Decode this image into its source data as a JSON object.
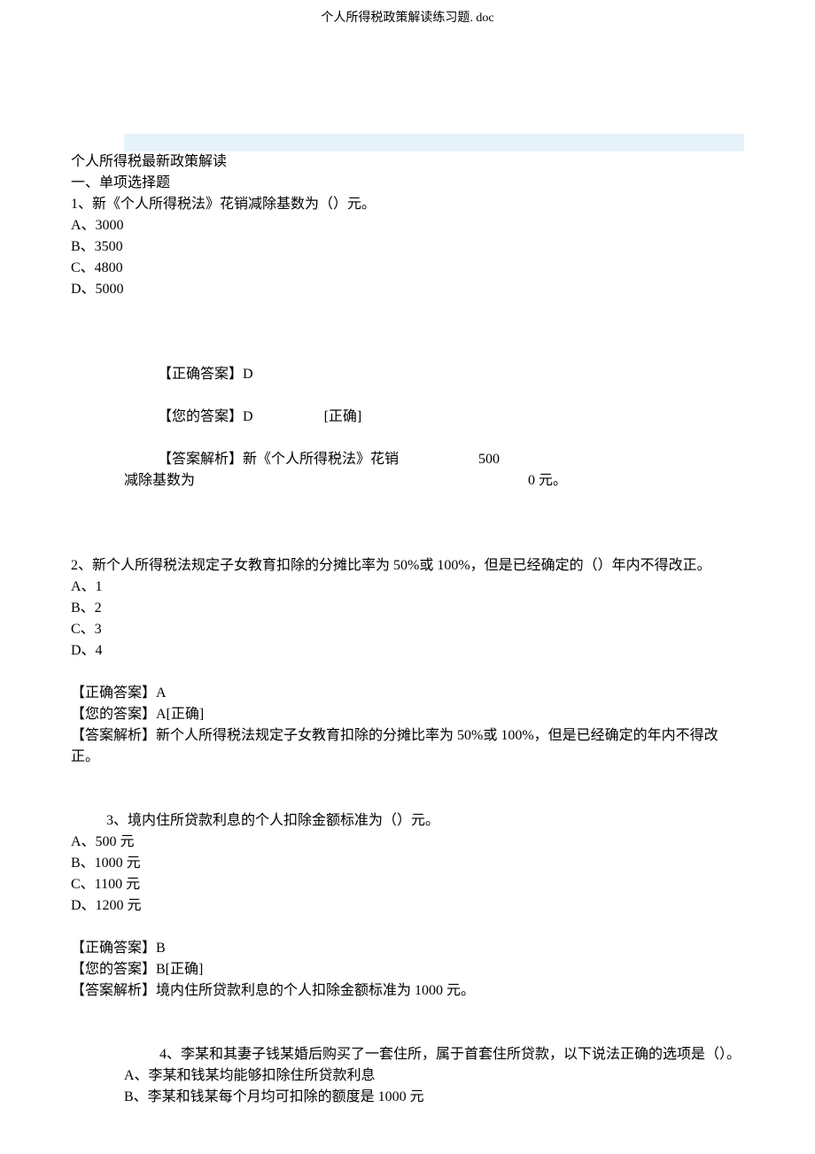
{
  "doc_filename": "个人所得税政策解读练习题. doc",
  "title": "个人所得税最新政策解读",
  "section_heading": "一、单项选择题",
  "q1": {
    "prompt": "1、新《个人所得税法》花销减除基数为（）元。",
    "opts": {
      "a": "A、3000",
      "b": "B、3500",
      "c": "C、4800",
      "d": "D、5000"
    },
    "correct_label": "【正确答案】D",
    "your_label": "【您的答案】D",
    "correct_tag": "[正确]",
    "analysis_l1a": "【答案解析】新《个人所得税法》花销",
    "analysis_l1b": "500",
    "analysis_l2a": "减除基数为",
    "analysis_l2b": "0 元。"
  },
  "q2": {
    "prompt": "2、新个人所得税法规定子女教育扣除的分摊比率为 50%或 100%，但是已经确定的（）年内不得改正。",
    "opts": {
      "a": "A、1",
      "b": "B、2",
      "c": "C、3",
      "d": "D、4"
    },
    "correct_label": "【正确答案】A",
    "your_label": "【您的答案】A[正确]",
    "analysis": "【答案解析】新个人所得税法规定子女教育扣除的分摊比率为 50%或 100%，但是已经确定的年内不得改正。"
  },
  "q3": {
    "prompt": "3、境内住所贷款利息的个人扣除金额标准为（）元。",
    "opts": {
      "a": "A、500 元",
      "b": "B、1000 元",
      "c": "C、1100 元",
      "d": "D、1200 元"
    },
    "correct_label": "【正确答案】B",
    "your_label": "【您的答案】B[正确]",
    "analysis": "【答案解析】境内住所贷款利息的个人扣除金额标准为 1000 元。"
  },
  "q4": {
    "prompt": "4、李某和其妻子钱某婚后购买了一套住所，属于首套住所贷款，以下说法正确的选项是（）。",
    "opts": {
      "a": "A、李某和钱某均能够扣除住所贷款利息",
      "b": "B、李某和钱某每个月均可扣除的额度是 1000 元"
    }
  }
}
